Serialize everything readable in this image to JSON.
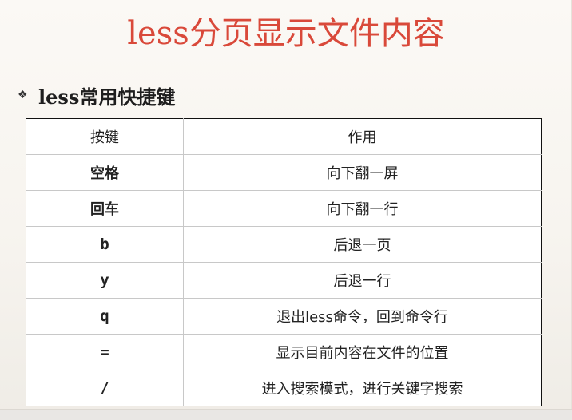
{
  "slide": {
    "title": "less分页显示文件内容",
    "bullet_icon": "diamond-bullet-icon",
    "bullet_symbol": "❖",
    "bullet_text": "less常用快捷键"
  },
  "table": {
    "headers": [
      "按键",
      "作用"
    ],
    "rows": [
      {
        "key": "空格",
        "action": "向下翻一屏"
      },
      {
        "key": "回车",
        "action": "向下翻一行"
      },
      {
        "key": "b",
        "action": "后退一页"
      },
      {
        "key": "y",
        "action": "后退一行"
      },
      {
        "key": "q",
        "action": "退出less命令，回到命令行"
      },
      {
        "key": "=",
        "action": "显示目前内容在文件的位置"
      },
      {
        "key": "/",
        "action": "进入搜索模式，进行关键字搜索"
      }
    ]
  },
  "colors": {
    "title": "#d9493a",
    "text": "#222222",
    "table_border": "#111111"
  }
}
